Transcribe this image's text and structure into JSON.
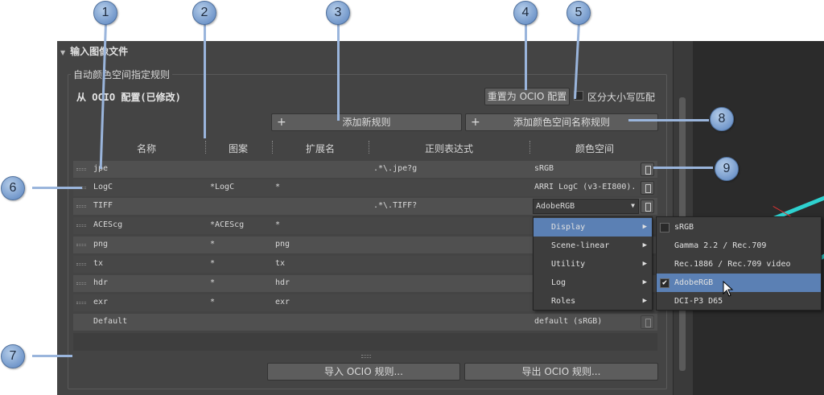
{
  "section": {
    "title": "输入图像文件"
  },
  "group": {
    "title": "自动颜色空间指定规则"
  },
  "config_label": "从 OCIO 配置(已修改)",
  "buttons": {
    "reset": "重置为 OCIO 配置",
    "add_rule": "添加新规则",
    "add_cs_rule": "添加颜色空间名称规则",
    "import": "导入 OCIO 规则...",
    "export": "导出 OCIO 规则..."
  },
  "case_match": "区分大小写匹配",
  "columns": [
    "名称",
    "图案",
    "扩展名",
    "正则表达式",
    "颜色空间"
  ],
  "rows": [
    {
      "name": "jpe",
      "pattern": "",
      "ext": "",
      "regex": ".*\\.jpe?g",
      "cs": "sRGB"
    },
    {
      "name": "LogC",
      "pattern": "*LogC",
      "ext": "*",
      "regex": "",
      "cs": "ARRI LogC (v3-EI800)."
    },
    {
      "name": "TIFF",
      "pattern": "",
      "ext": "",
      "regex": ".*\\.TIFF?",
      "cs": "AdobeRGB"
    },
    {
      "name": "ACEScg",
      "pattern": "*ACEScg",
      "ext": "*",
      "regex": "",
      "cs": ""
    },
    {
      "name": "png",
      "pattern": "*",
      "ext": "png",
      "regex": "",
      "cs": ""
    },
    {
      "name": "tx",
      "pattern": "*",
      "ext": "tx",
      "regex": "",
      "cs": ""
    },
    {
      "name": "hdr",
      "pattern": "*",
      "ext": "hdr",
      "regex": "",
      "cs": ""
    },
    {
      "name": "exr",
      "pattern": "*",
      "ext": "exr",
      "regex": "",
      "cs": ""
    },
    {
      "name": "Default",
      "pattern": "",
      "ext": "",
      "regex": "",
      "cs": "default (sRGB)"
    }
  ],
  "menu": [
    "Display",
    "Scene-linear",
    "Utility",
    "Log",
    "Roles"
  ],
  "submenu": [
    "sRGB",
    "Gamma 2.2 / Rec.709",
    "Rec.1886 / Rec.709 video",
    "AdobeRGB",
    "DCI-P3 D65"
  ],
  "callouts": [
    "1",
    "2",
    "3",
    "4",
    "5",
    "6",
    "7",
    "8",
    "9"
  ],
  "colors": {
    "accent": "#5b80b4",
    "callout": "#7fa3d3",
    "panel": "#444444"
  }
}
